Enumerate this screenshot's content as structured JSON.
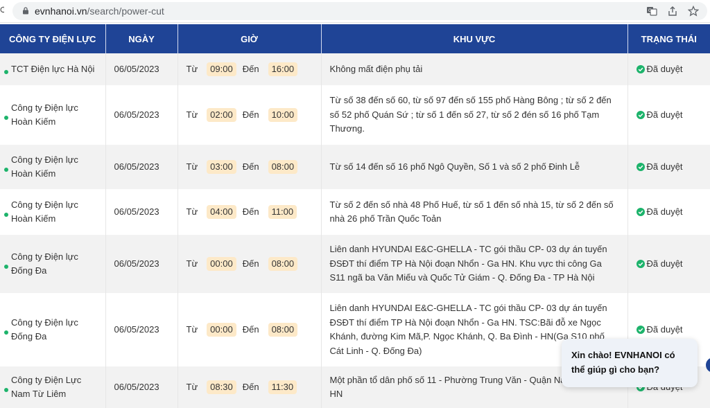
{
  "browser": {
    "url_host": "evnhanoi.vn",
    "url_path": "/search/power-cut"
  },
  "table": {
    "columns": [
      "CÔNG TY ĐIỆN LỰC",
      "NGÀY",
      "GIỜ",
      "KHU VỰC",
      "TRẠNG THÁI"
    ],
    "from_label": "Từ",
    "to_label": "Đến",
    "rows": [
      {
        "company": "TCT Điện lực Hà Nội",
        "date": "06/05/2023",
        "from": "09:00",
        "to": "16:00",
        "area": "Không mất điện phụ tải",
        "status": "Đã duyệt"
      },
      {
        "company": "Công ty Điện lực Hoàn Kiếm",
        "date": "06/05/2023",
        "from": "02:00",
        "to": "10:00",
        "area": "Từ số 38 đến số 60, từ số 97 đến số 155 phố Hàng Bông ; từ số 2 đến số 52 phố Quán Sứ ; từ số 1 đến số 27, từ số 2 đén số 16 phố Tạm Thương.",
        "status": "Đã duyệt"
      },
      {
        "company": "Công ty Điện lực Hoàn Kiếm",
        "date": "06/05/2023",
        "from": "03:00",
        "to": "08:00",
        "area": "Từ số 14 đến số 16 phố Ngô Quyền, Số 1 và số 2 phố Đinh Lễ",
        "status": "Đã duyệt"
      },
      {
        "company": "Công ty Điện lực Hoàn Kiếm",
        "date": "06/05/2023",
        "from": "04:00",
        "to": "11:00",
        "area": "Từ số 2 đến số nhà 48 Phố Huế, từ số 1 đến số nhà 15, từ số 2 đến số nhà 26 phố Trần Quốc Toản",
        "status": "Đã duyệt"
      },
      {
        "company": "Công ty Điện lực Đống Đa",
        "date": "06/05/2023",
        "from": "00:00",
        "to": "08:00",
        "area": "Liên danh HYUNDAI E&C-GHELLA - TC gói thầu CP- 03 dự án tuyến ĐSĐT thí điểm TP Hà Nội đoạn Nhổn - Ga HN. Khu vực thi công Ga S11 ngã ba Văn Miếu và Quốc Tử Giám - Q. Đống Đa - TP Hà Nội",
        "status": "Đã duyệt"
      },
      {
        "company": "Công ty Điện lực Đống Đa",
        "date": "06/05/2023",
        "from": "00:00",
        "to": "08:00",
        "area": "Liên danh HYUNDAI E&C-GHELLA - TC gói thầu CP- 03 dự án tuyến ĐSĐT thí điểm TP Hà Nội đoạn Nhổn - Ga HN. TSC:Bãi đỗ xe Ngọc Khánh, đường Kim Mã,P. Ngọc Khánh, Q. Ba Đình - HN(Ga S10 phố Cát Linh - Q. Đống Đa)",
        "status": "Đã duyệt"
      },
      {
        "company": "Công ty Điện Lực Nam Từ Liêm",
        "date": "06/05/2023",
        "from": "08:30",
        "to": "11:30",
        "area": "Một phần tổ dân phố số 11 - Phường Trung Văn - Quận Nam Từ Liêm - HN",
        "status": "Đã duyệt"
      }
    ]
  },
  "chat": {
    "message": "Xin chào! EVNHANOI có thể giúp gì cho bạn?"
  },
  "colors": {
    "header_bg": "#1f4496",
    "date_red": "#e0323c",
    "time_pill": "#fde9c8",
    "status_green": "#1db36b"
  },
  "icons": [
    "reload-icon",
    "lock-icon",
    "translate-icon",
    "share-icon",
    "star-icon",
    "status-dot-icon",
    "check-circle-icon"
  ]
}
